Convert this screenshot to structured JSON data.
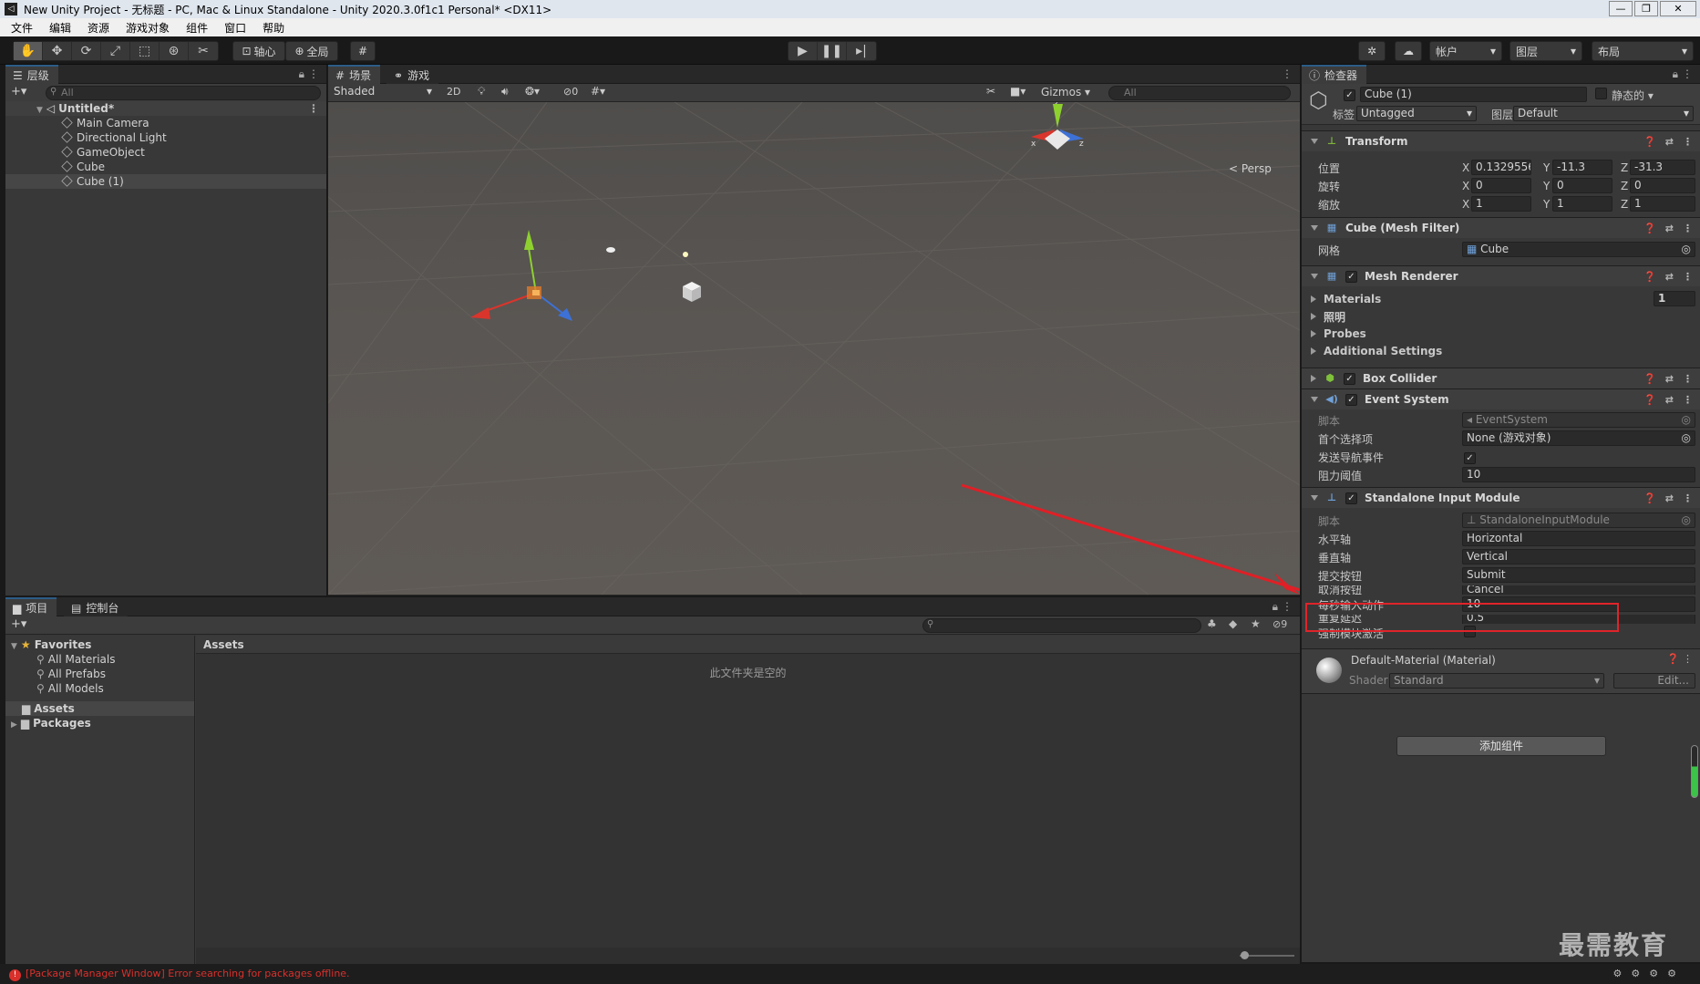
{
  "window": {
    "title": "New Unity Project - 无标题 - PC, Mac & Linux Standalone - Unity 2020.3.0f1c1 Personal* <DX11>",
    "controls": [
      "—",
      "❐",
      "✕"
    ]
  },
  "menu": [
    "文件",
    "编辑",
    "资源",
    "游戏对象",
    "组件",
    "窗口",
    "帮助"
  ],
  "toolbar": {
    "pivot": "轴心",
    "global": "全局",
    "account": "帐户",
    "layers": "图层",
    "layout": "布局"
  },
  "hierarchy": {
    "tab": "层级",
    "search_placeholder": "All",
    "scene": "Untitled*",
    "items": [
      "Main Camera",
      "Directional Light",
      "GameObject",
      "Cube",
      "Cube (1)"
    ]
  },
  "scene_view": {
    "tabs": [
      "场景",
      "游戏"
    ],
    "shading": "Shaded",
    "mode_2d": "2D",
    "hidden_count": "0",
    "gizmos": "Gizmos",
    "search_placeholder": "All",
    "persp": "< Persp"
  },
  "project": {
    "tabs": [
      "项目",
      "控制台"
    ],
    "favorites": "Favorites",
    "fav_items": [
      "All Materials",
      "All Prefabs",
      "All Models"
    ],
    "folders": [
      "Assets",
      "Packages"
    ],
    "breadcrumb": "Assets",
    "empty": "此文件夹是空的",
    "hidden_count": "9"
  },
  "status": {
    "error": "[Package Manager Window] Error searching for packages offline."
  },
  "inspector": {
    "tab": "检查器",
    "object_name": "Cube (1)",
    "static_label": "静态的",
    "tag_label": "标签",
    "tag": "Untagged",
    "layer_label": "图层",
    "layer": "Default",
    "transform": {
      "title": "Transform",
      "rows": [
        {
          "label": "位置",
          "x": "0.1329556",
          "y": "-11.3",
          "z": "-31.3"
        },
        {
          "label": "旋转",
          "x": "0",
          "y": "0",
          "z": "0"
        },
        {
          "label": "缩放",
          "x": "1",
          "y": "1",
          "z": "1"
        }
      ]
    },
    "mesh_filter": {
      "title": "Cube (Mesh Filter)",
      "label": "网格",
      "value": "Cube"
    },
    "mesh_renderer": {
      "title": "Mesh Renderer",
      "materials": "Materials",
      "materials_count": "1",
      "lighting": "照明",
      "probes": "Probes",
      "additional": "Additional Settings"
    },
    "box_collider": {
      "title": "Box Collider"
    },
    "event_system": {
      "title": "Event System",
      "rows": [
        {
          "label": "脚本",
          "value": "EventSystem"
        },
        {
          "label": "首个选择项",
          "value": "None (游戏对象)"
        },
        {
          "label": "发送导航事件",
          "value": "✓"
        },
        {
          "label": "阻力阈值",
          "value": "10"
        }
      ]
    },
    "standalone": {
      "title": "Standalone Input Module",
      "rows": [
        {
          "label": "脚本",
          "value": "StandaloneInputModule"
        },
        {
          "label": "水平轴",
          "value": "Horizontal"
        },
        {
          "label": "垂直轴",
          "value": "Vertical"
        },
        {
          "label": "提交按钮",
          "value": "Submit"
        },
        {
          "label": "取消按钮",
          "value": "Cancel"
        },
        {
          "label": "每秒输入动作",
          "value": "10"
        },
        {
          "label": "重复延迟",
          "value": "0.5"
        },
        {
          "label": "强制模块激活",
          "value": ""
        }
      ]
    },
    "material": {
      "title": "Default-Material (Material)",
      "shader_label": "Shader",
      "shader": "Standard",
      "edit": "Edit..."
    },
    "add_component": "添加组件"
  },
  "watermark": "最需教育",
  "colors": {
    "highlight": "#e0242a",
    "accent": "#2c5d87",
    "error": "#d9302c"
  }
}
